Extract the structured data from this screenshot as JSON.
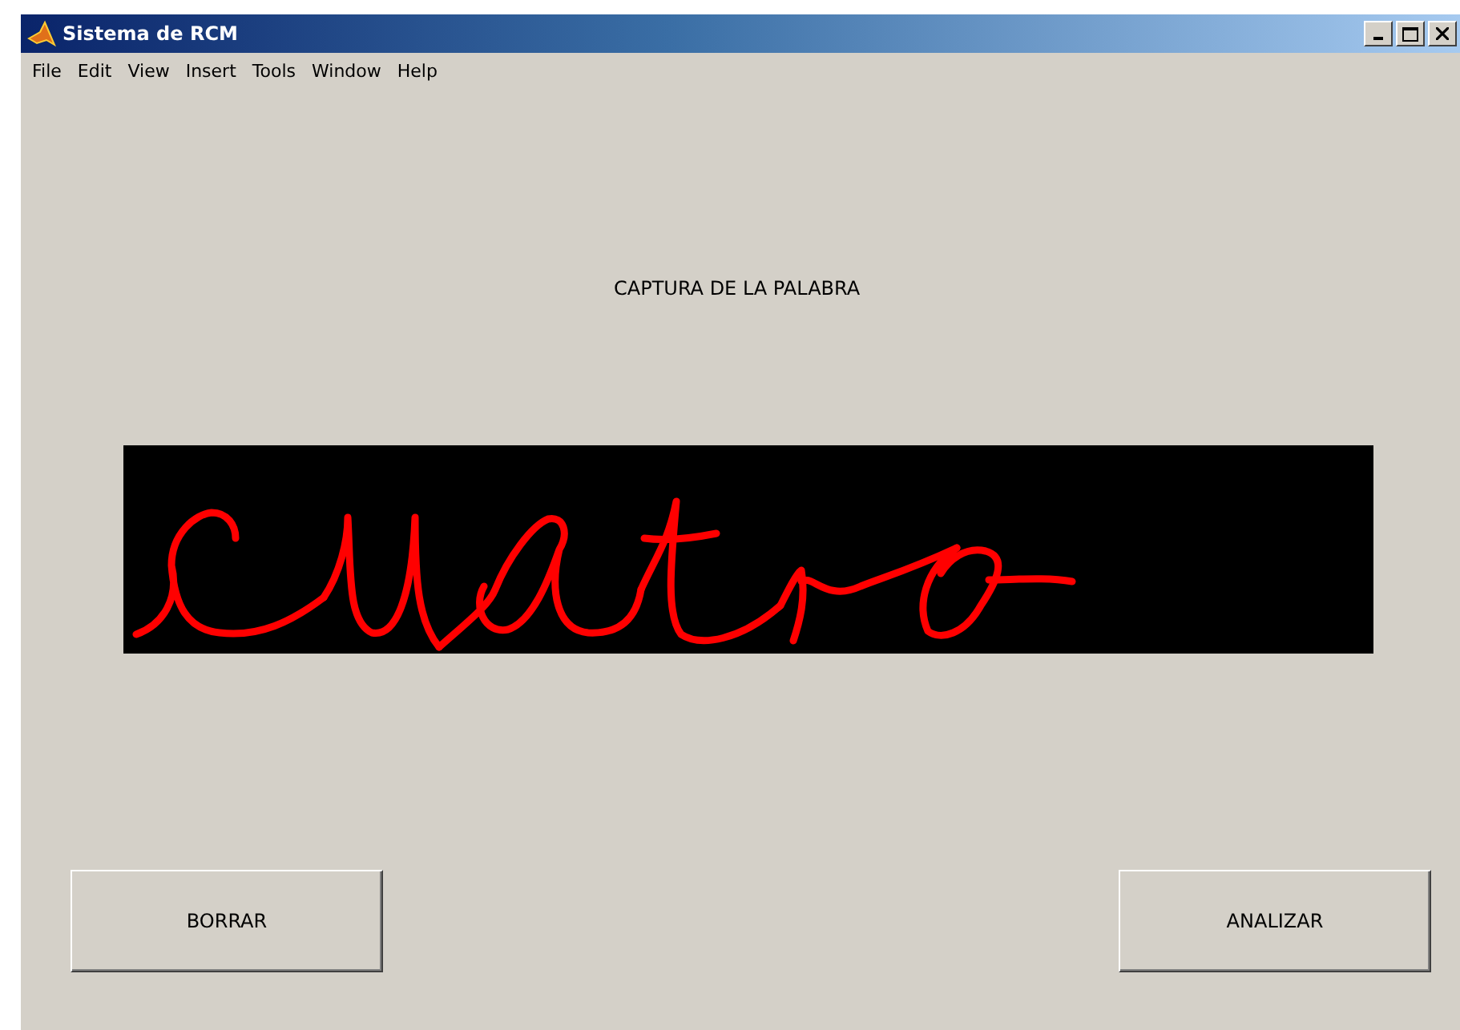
{
  "window": {
    "title": "Sistema de RCM"
  },
  "menu": [
    "File",
    "Edit",
    "View",
    "Insert",
    "Tools",
    "Window",
    "Help"
  ],
  "prompt": "CAPTURA DE LA PALABRA",
  "buttons": [
    "BORRAR",
    "ANALIZAR"
  ]
}
